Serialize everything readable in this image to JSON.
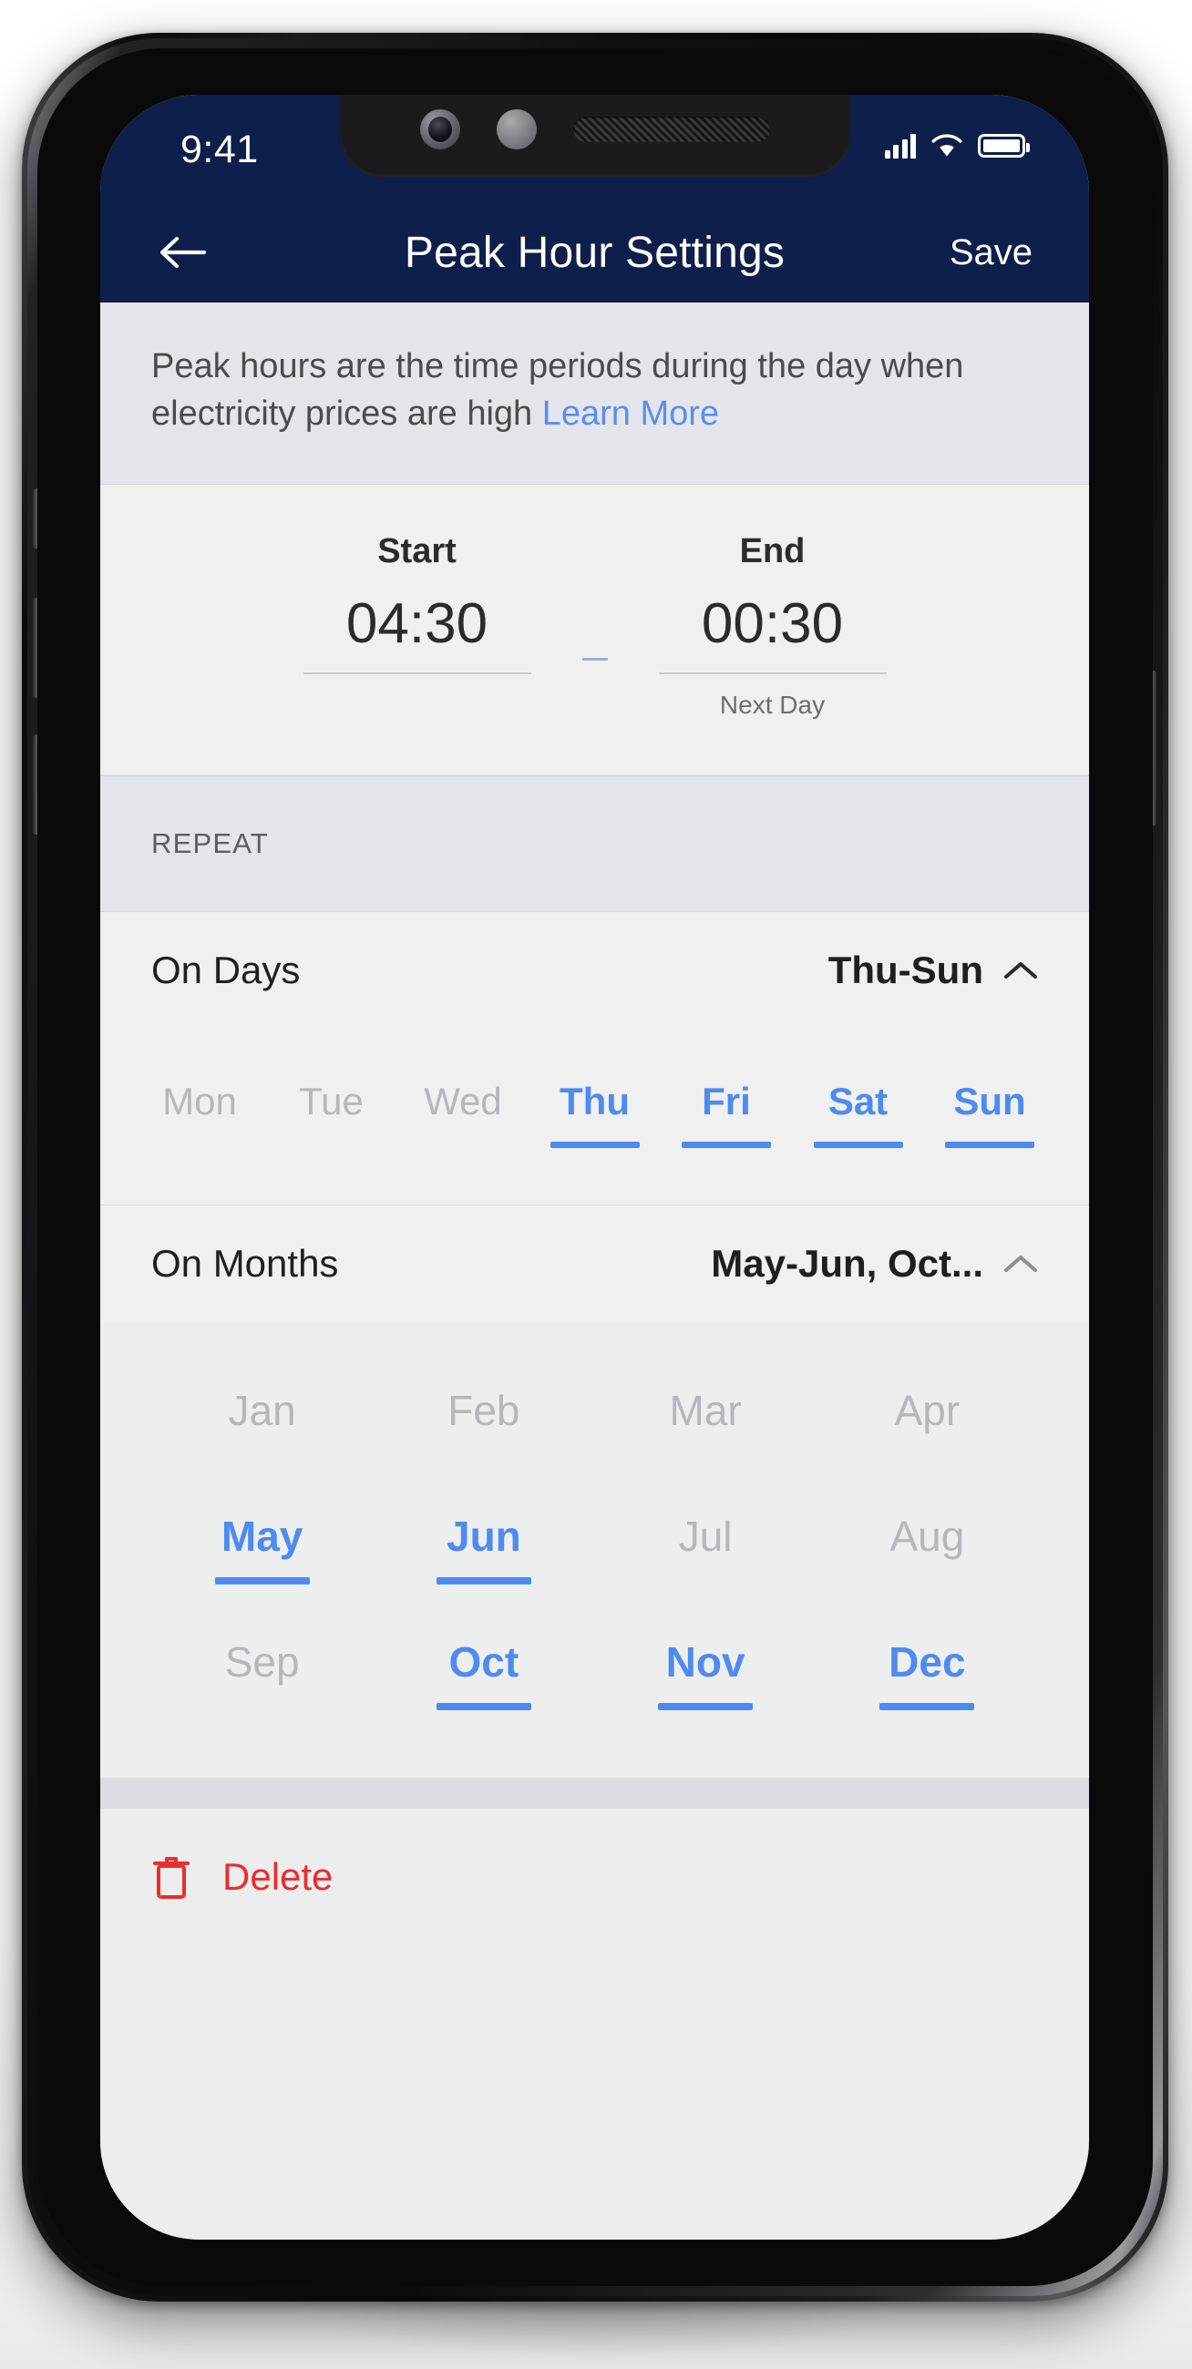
{
  "status_bar": {
    "time": "9:41",
    "signal_icon": "cellular-signal-icon",
    "wifi_icon": "wifi-icon",
    "battery_icon": "battery-full-icon"
  },
  "nav": {
    "back_icon": "back-arrow-icon",
    "title": "Peak Hour Settings",
    "save_label": "Save"
  },
  "description": {
    "text": "Peak hours are the time periods during the day when electricity prices are high ",
    "link_label": "Learn More"
  },
  "time": {
    "start_label": "Start",
    "start_value": "04:30",
    "separator": "—",
    "end_label": "End",
    "end_value": "00:30",
    "end_note": "Next Day"
  },
  "repeat": {
    "section_title": "REPEAT",
    "days_row": {
      "label": "On Days",
      "value": "Thu-Sun",
      "chevron_icon": "chevron-up-icon"
    },
    "days": [
      {
        "label": "Mon",
        "selected": false
      },
      {
        "label": "Tue",
        "selected": false
      },
      {
        "label": "Wed",
        "selected": false
      },
      {
        "label": "Thu",
        "selected": true
      },
      {
        "label": "Fri",
        "selected": true
      },
      {
        "label": "Sat",
        "selected": true
      },
      {
        "label": "Sun",
        "selected": true
      }
    ],
    "months_row": {
      "label": "On Months",
      "value": "May-Jun, Oct...",
      "chevron_icon": "chevron-up-icon"
    },
    "months": [
      {
        "label": "Jan",
        "selected": false
      },
      {
        "label": "Feb",
        "selected": false
      },
      {
        "label": "Mar",
        "selected": false
      },
      {
        "label": "Apr",
        "selected": false
      },
      {
        "label": "May",
        "selected": true
      },
      {
        "label": "Jun",
        "selected": true
      },
      {
        "label": "Jul",
        "selected": false
      },
      {
        "label": "Aug",
        "selected": false
      },
      {
        "label": "Sep",
        "selected": false
      },
      {
        "label": "Oct",
        "selected": true
      },
      {
        "label": "Nov",
        "selected": true
      },
      {
        "label": "Dec",
        "selected": true
      }
    ]
  },
  "footer": {
    "delete_label": "Delete",
    "delete_icon": "trash-icon"
  },
  "colors": {
    "header_navy": "#0d1f4a",
    "accent_blue": "#4d8bf0",
    "link_blue": "#5b8def",
    "danger_red": "#ea2d2d",
    "muted_gray": "#b6b7bc"
  }
}
